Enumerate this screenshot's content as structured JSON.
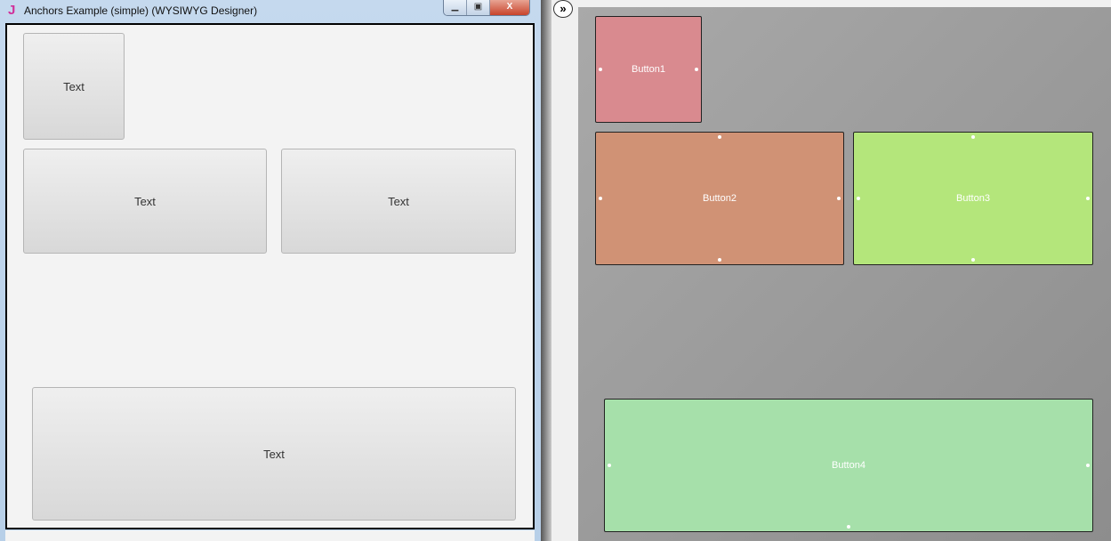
{
  "window": {
    "title": "Anchors Example (simple) (WYSIWYG Designer)",
    "icon": "J",
    "controls": {
      "minimize": "▭",
      "maximize": "▢",
      "close": "X"
    }
  },
  "preview": {
    "buttons": [
      "Text",
      "Text",
      "Text",
      "Text"
    ]
  },
  "designer": {
    "collapse_icon": "»",
    "buttons": [
      {
        "label": "Button1",
        "color": "#d98a8f"
      },
      {
        "label": "Button2",
        "color": "#d09275"
      },
      {
        "label": "Button3",
        "color": "#b4e67b"
      },
      {
        "label": "Button4",
        "color": "#a6e0aa"
      }
    ]
  }
}
